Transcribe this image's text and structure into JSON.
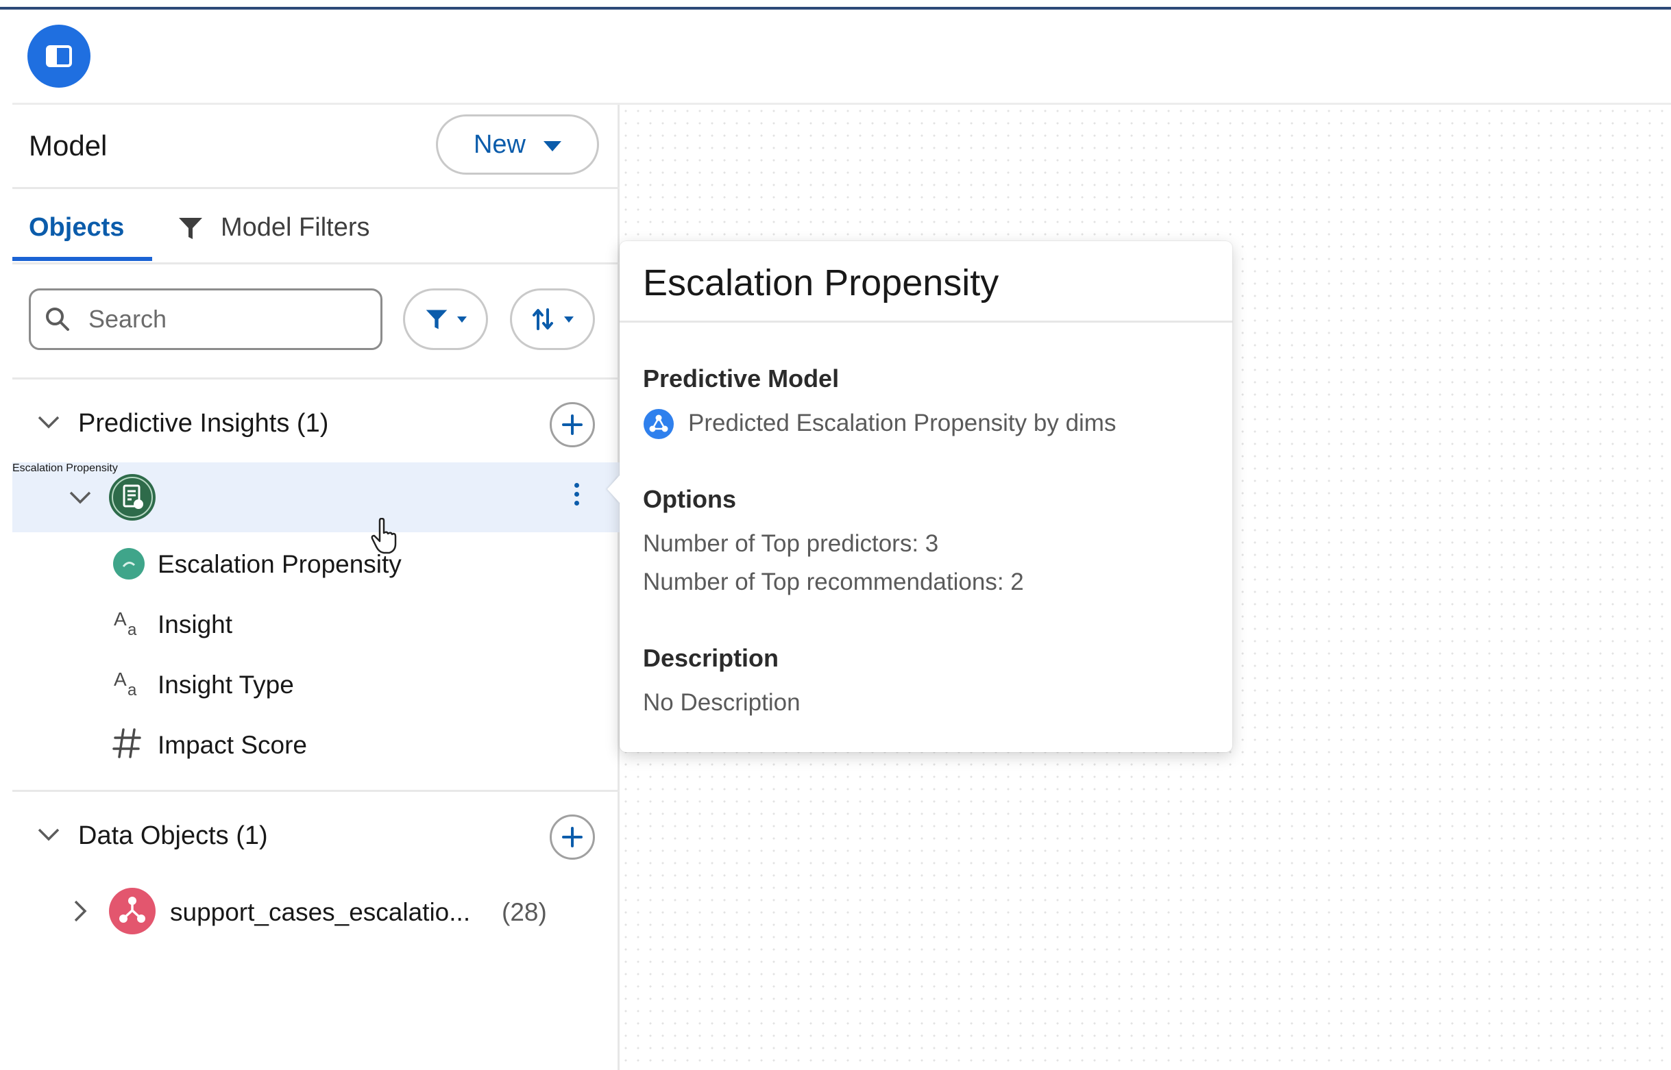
{
  "header": {
    "app_icon": "panel-toggle-icon"
  },
  "panel": {
    "title": "Model",
    "new_button": "New",
    "tabs": {
      "objects": "Objects",
      "model_filters": "Model Filters"
    },
    "search": {
      "placeholder": "Search"
    },
    "predictive_insights": {
      "label": "Predictive Insights (1)",
      "item": {
        "label": "Escalation Propensity",
        "children": [
          {
            "label": "Escalation Propensity",
            "icon": "prediction-icon"
          },
          {
            "label": "Insight",
            "icon": "text-type-icon"
          },
          {
            "label": "Insight Type",
            "icon": "text-type-icon"
          },
          {
            "label": "Impact Score",
            "icon": "number-type-icon"
          }
        ]
      }
    },
    "data_objects": {
      "label": "Data Objects (1)",
      "item": {
        "label": "support_cases_escalatio...",
        "count": "(28)"
      }
    }
  },
  "popover": {
    "title": "Escalation Propensity",
    "predictive_model_heading": "Predictive Model",
    "predictive_model_value": "Predicted Escalation Propensity by dims",
    "options_heading": "Options",
    "option_1": "Number of Top predictors: 3",
    "option_2": "Number of Top recommendations: 2",
    "description_heading": "Description",
    "description_value": "No Description"
  },
  "colors": {
    "accent": "#0b5cab",
    "selected_row": "#e9f0fb",
    "insight_icon": "#2e844a",
    "data_object_icon": "#e3566e"
  }
}
